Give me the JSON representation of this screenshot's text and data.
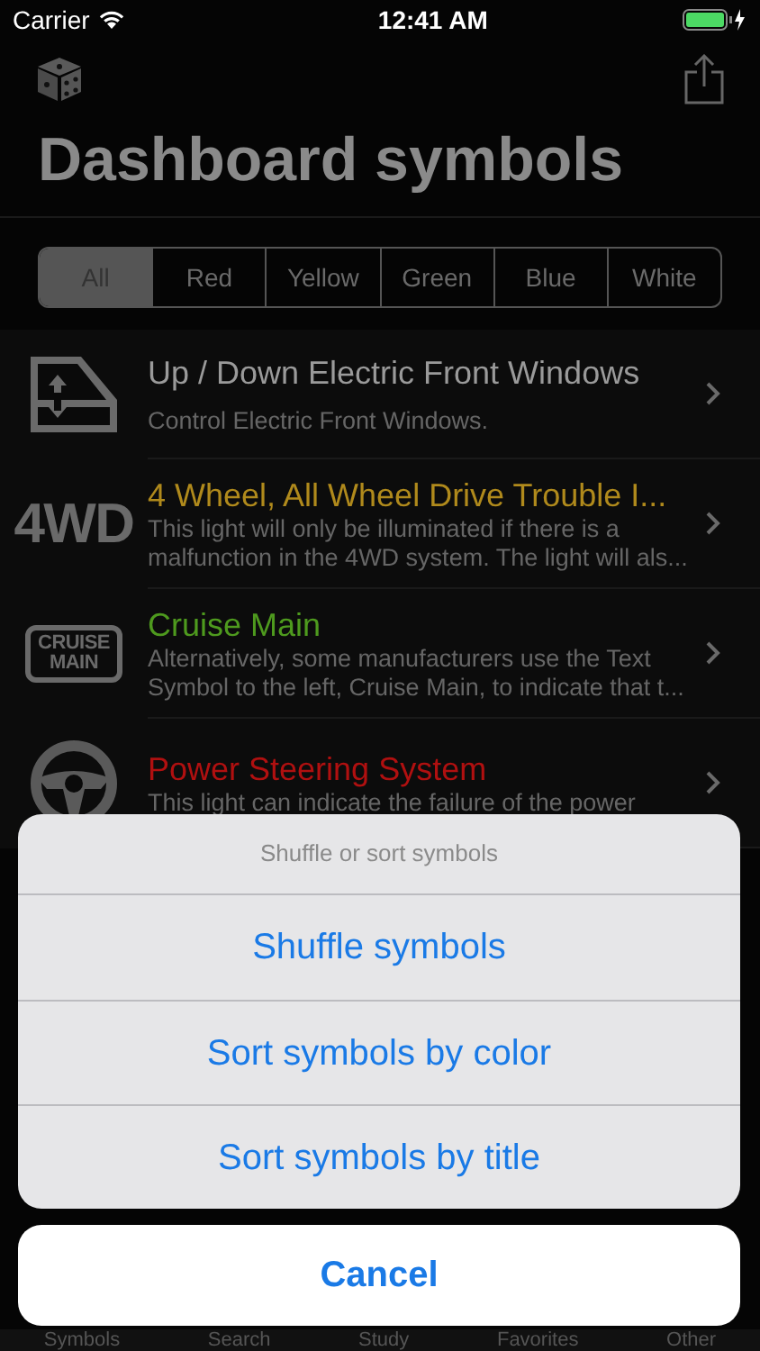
{
  "status_bar": {
    "carrier": "Carrier",
    "time": "12:41 AM"
  },
  "title": "Dashboard symbols",
  "filters": [
    {
      "label": "All",
      "selected": true
    },
    {
      "label": "Red",
      "selected": false
    },
    {
      "label": "Yellow",
      "selected": false
    },
    {
      "label": "Green",
      "selected": false
    },
    {
      "label": "Blue",
      "selected": false
    },
    {
      "label": "White",
      "selected": false
    }
  ],
  "symbols": [
    {
      "kind": "window",
      "title": "Up / Down Electric Front Windows",
      "description": "Control Electric Front Windows.",
      "color": "#9a9a9a"
    },
    {
      "kind": "text",
      "icon_text": [
        "4WD"
      ],
      "title": "4 Wheel, All Wheel Drive Trouble I...",
      "description": "This light will only be illuminated if there is a malfunction in the 4WD system. The light will als...",
      "color": "#b08a1c"
    },
    {
      "kind": "badge",
      "icon_text": [
        "CRUISE",
        "MAIN"
      ],
      "title": "Cruise Main",
      "description": "Alternatively, some manufacturers use the Text Symbol to the left, Cruise Main, to indicate that t...",
      "color": "#4e9a1e"
    },
    {
      "kind": "steering",
      "title": "Power Steering System",
      "description": "This light can indicate the failure of the power",
      "color": "#b01010"
    }
  ],
  "tab_bar": [
    "Symbols",
    "Search",
    "Study",
    "Favorites",
    "Other"
  ],
  "action_sheet": {
    "title": "Shuffle or sort symbols",
    "actions": [
      "Shuffle symbols",
      "Sort symbols by color",
      "Sort symbols by title"
    ],
    "cancel": "Cancel"
  }
}
